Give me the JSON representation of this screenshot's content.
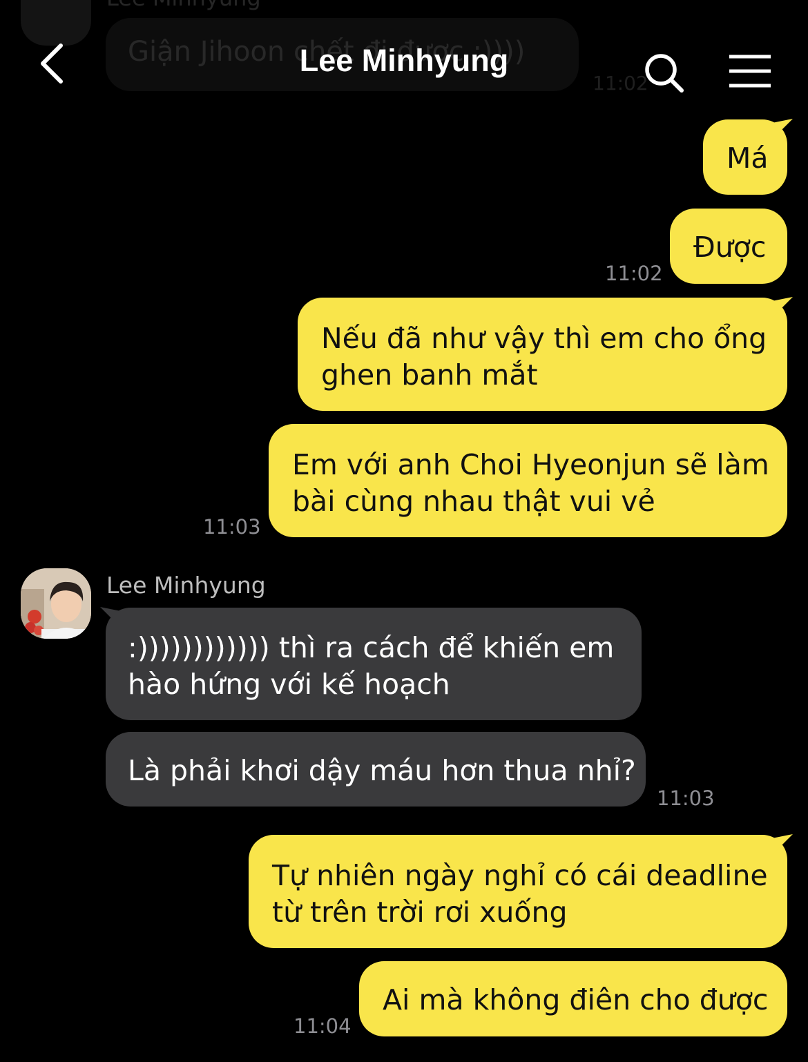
{
  "header": {
    "title": "Lee Minhyung"
  },
  "faded_top": {
    "sender": "Lee Minhyung",
    "message": "Giận Jihoon chết đi được :))))",
    "time": "11:02"
  },
  "messages": [
    {
      "text": "Má"
    },
    {
      "text": "Được",
      "time": "11:02"
    },
    {
      "lines": [
        "Nếu đã như vậy thì em cho ổng",
        "ghen banh mắt"
      ]
    },
    {
      "lines": [
        "Em với anh Choi Hyeonjun sẽ làm",
        "bài cùng nhau thật vui vẻ"
      ],
      "time": "11:03"
    },
    {
      "sender": "Lee Minhyung",
      "lines": [
        ":)))))))))))) thì ra cách để khiến em",
        "hào hứng với kế hoạch"
      ]
    },
    {
      "text": "Là phải khơi dậy máu hơn thua nhỉ?",
      "time": "11:03"
    },
    {
      "lines": [
        "Tự nhiên ngày nghỉ có cái deadline",
        "từ trên trời rơi xuống"
      ]
    },
    {
      "text": "Ai mà không điên cho được",
      "time": "11:04"
    }
  ],
  "colors": {
    "mine_bubble": "#f9e54b",
    "theirs_bubble": "#3a3a3c",
    "background": "#000000",
    "timestamp": "#8e8e93"
  },
  "icons": [
    "back-icon",
    "search-icon",
    "menu-icon"
  ]
}
